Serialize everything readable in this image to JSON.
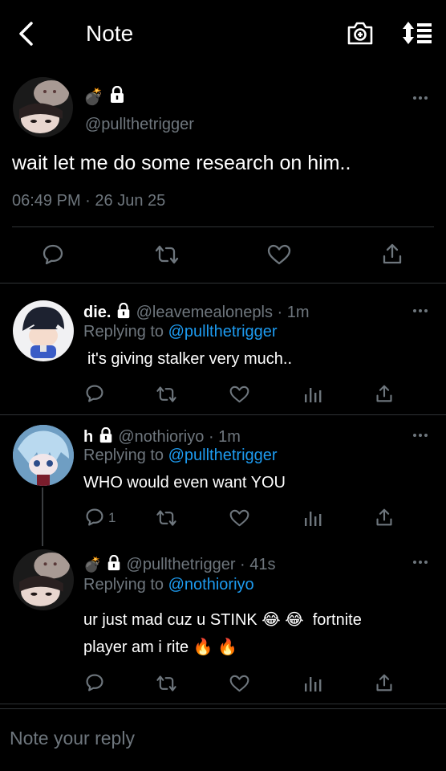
{
  "header": {
    "title": "Note",
    "back_icon": "chevron-left-icon",
    "camera_icon": "camera-plus-icon",
    "sort_icon": "sort-icon"
  },
  "main_post": {
    "emoji": "💣",
    "handle": "@pullthetrigger",
    "text": "wait let me do some research on him..",
    "time": "06:49 PM",
    "separator": "·",
    "date": "26 Jun 25"
  },
  "replies": [
    {
      "name": "die.",
      "handle": "@leavemealonepls",
      "time": "· 1m",
      "replying_prefix": "Replying to",
      "replying_to": "@pullthetrigger",
      "text": "it's giving stalker very much.."
    },
    {
      "name": "h",
      "handle": "@nothioriyo",
      "time": "· 1m",
      "replying_prefix": "Replying to",
      "replying_to": "@pullthetrigger",
      "text": "WHO would even want YOU",
      "reply_count": "1"
    },
    {
      "emoji": "💣",
      "handle": "@pullthetrigger",
      "time": "· 41s",
      "replying_prefix": "Replying to",
      "replying_to": "@nothioriyo",
      "text_line1": "ur just mad cuz u STINK 😂 😂  fortnite",
      "text_line2": "player am i rite 🔥 🔥"
    }
  ],
  "composer": {
    "placeholder": "Note your reply"
  },
  "colors": {
    "background": "#000000",
    "muted": "#6e767d",
    "link": "#1d9bf0",
    "divider": "#2f3336"
  }
}
